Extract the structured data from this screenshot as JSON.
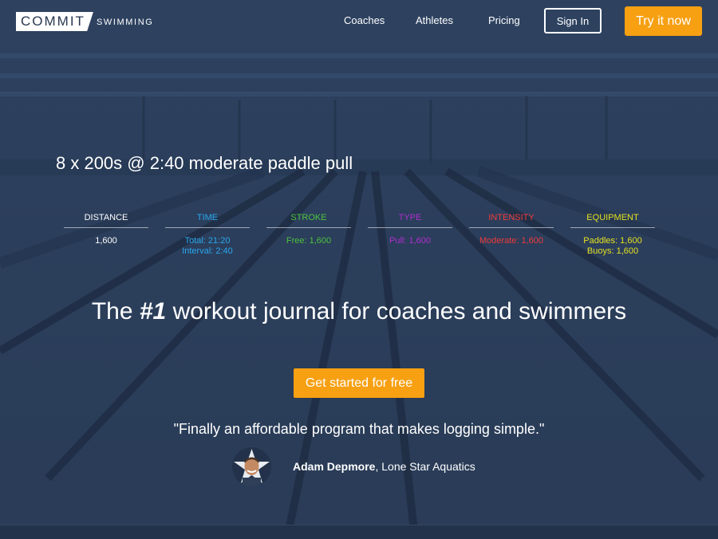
{
  "nav": {
    "logo_main": "COMMIT",
    "logo_sub": "SWIMMING",
    "links": [
      "Coaches",
      "Athletes",
      "Pricing"
    ],
    "sign_in": "Sign In",
    "try_now": "Try it now"
  },
  "workout": {
    "title": "8 x 200s @ 2:40 moderate paddle pull",
    "columns": [
      {
        "head": "DISTANCE",
        "lines": [
          "1,600"
        ],
        "color": "#ffffff"
      },
      {
        "head": "TIME",
        "lines": [
          "Total: 21:20",
          "Interval: 2:40"
        ],
        "color": "#2aa7ee"
      },
      {
        "head": "STROKE",
        "lines": [
          "Free: 1,600"
        ],
        "color": "#4cc13f"
      },
      {
        "head": "TYPE",
        "lines": [
          "Pull: 1,600"
        ],
        "color": "#b02fd0"
      },
      {
        "head": "INTENSITY",
        "lines": [
          "Moderate: 1,600"
        ],
        "color": "#ee3b3b"
      },
      {
        "head": "EQUIPMENT",
        "lines": [
          "Paddles: 1,600",
          "Buoys: 1,600"
        ],
        "color": "#e4e021"
      }
    ]
  },
  "hero": {
    "prefix": "The ",
    "highlight": "#1",
    "suffix": " workout journal for coaches and swimmers"
  },
  "cta": "Get started for free",
  "testimonial": {
    "quote": "\"Finally an affordable program that makes logging simple.\"",
    "name": "Adam Depmore",
    "org": ", Lone Star Aquatics"
  },
  "colors": {
    "accent": "#f7a012",
    "background": "#2a3c58"
  }
}
